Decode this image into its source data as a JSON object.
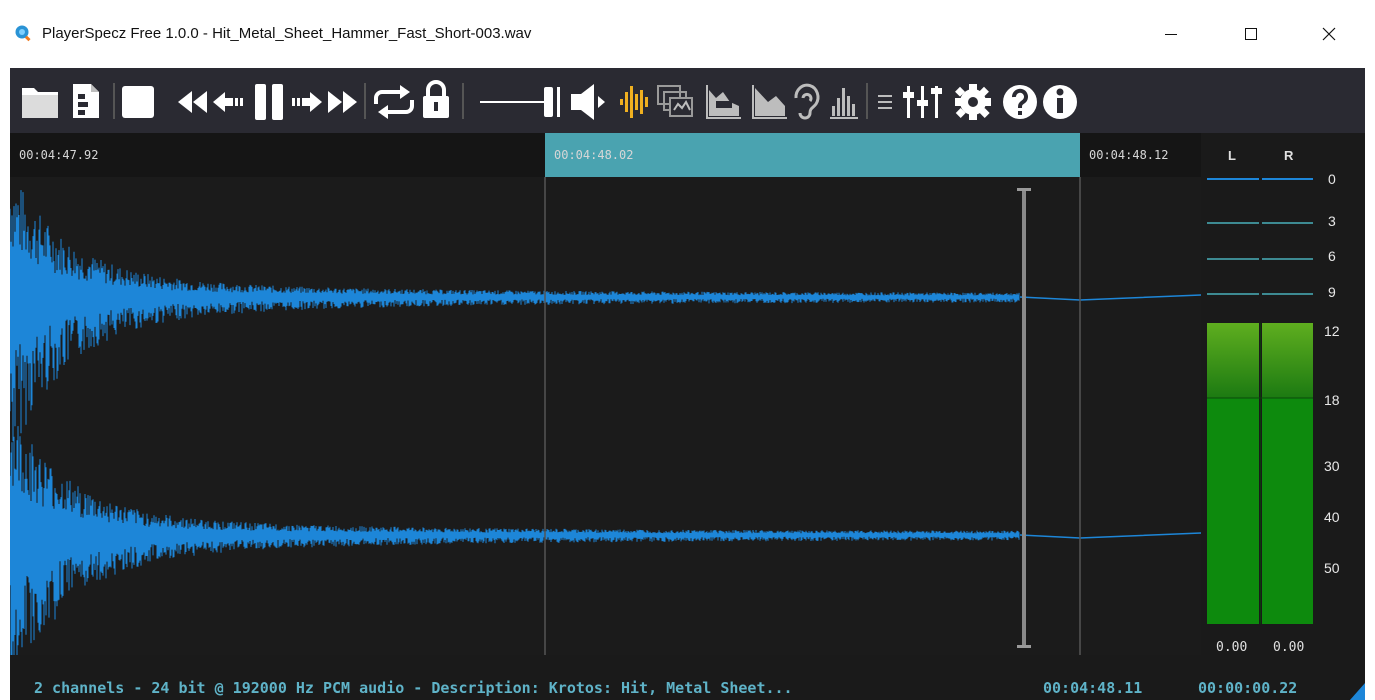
{
  "window": {
    "title": "PlayerSpecz Free 1.0.0 - Hit_Metal_Sheet_Hammer_Fast_Short-003.wav",
    "controls": {
      "minimize": "—",
      "maximize": "☐",
      "close": "✕"
    }
  },
  "toolbar": {
    "icons": [
      "open-folder-icon",
      "open-file-icon",
      "stop-icon",
      "rewind-icon",
      "step-back-icon",
      "pause-icon",
      "step-forward-icon",
      "fast-forward-icon",
      "loop-icon",
      "lock-icon",
      "volume-slider-icon",
      "speaker-icon",
      "waveform-view-icon",
      "multi-view-icon",
      "spectrum-view-icon",
      "area-view-icon",
      "ear-icon",
      "histogram-icon",
      "menu-icon",
      "mixer-icon",
      "settings-icon",
      "help-icon",
      "info-icon"
    ],
    "accent_color": "#f0b020"
  },
  "timeline": {
    "left_time": "00:04:47.92",
    "sel_time": "00:04:48.02",
    "right_time": "00:04:48.12"
  },
  "meter": {
    "channels": [
      "L",
      "R"
    ],
    "scale": [
      "0",
      "3",
      "6",
      "9",
      "12",
      "18",
      "30",
      "40",
      "50"
    ],
    "values": [
      "0.00",
      "0.00"
    ],
    "level_color": "#1f9a1f"
  },
  "status": {
    "info": "2 channels - 24 bit @ 192000 Hz PCM audio - Description: Krotos: Hit, Metal Sheet...",
    "position": "00:04:48.11",
    "duration": "00:00:00.22"
  },
  "colors": {
    "wave": "#1d86d8",
    "selection": "#4aa3b0",
    "status_text": "#5fb3c8"
  }
}
